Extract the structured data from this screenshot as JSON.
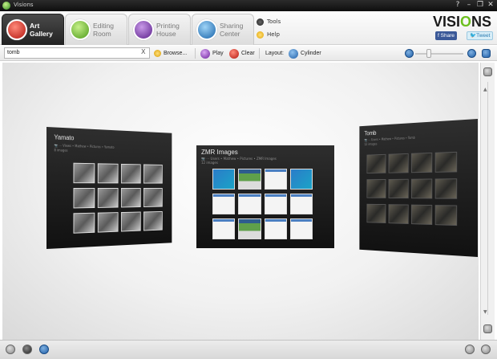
{
  "window": {
    "title": "Visions",
    "min": "?",
    "minimize": "–",
    "restore": "❐",
    "close": "✕"
  },
  "tabs": [
    {
      "line1": "Art",
      "line2": "Gallery",
      "color": "#d8332a",
      "active": true
    },
    {
      "line1": "Editing",
      "line2": "Room",
      "color": "#7dbf2e",
      "active": false
    },
    {
      "line1": "Printing",
      "line2": "House",
      "color": "#7e3fa8",
      "active": false
    },
    {
      "line1": "Sharing",
      "line2": "Center",
      "color": "#2f87c9",
      "active": false
    }
  ],
  "side_links": {
    "tools": "Tools",
    "help": "Help"
  },
  "brand": {
    "pre": "VISI",
    "o": "O",
    "post": "NS",
    "share": "Share",
    "tweet": "Tweet"
  },
  "toolbar": {
    "search_value": "tomb",
    "search_clear": "X",
    "browse": "Browse...",
    "play": "Play",
    "clear": "Clear",
    "layout_label": "Layout:",
    "layout_value": "Cylinder"
  },
  "panels": {
    "left": {
      "title": "Yamato",
      "subtitle": "📷 ⋯ Views • Mathew • Pictures • Yamato",
      "subtitle2": "8 images"
    },
    "center": {
      "title": "ZMR Images",
      "subtitle": "📷 ⋯ Users • Mathew • Pictures • ZMR Images",
      "subtitle2": "12 images"
    },
    "right": {
      "title": "Tomb",
      "subtitle": "📷 ⋯ Users • Mathew • Pictures • Tomb",
      "subtitle2": "12 images"
    }
  },
  "scroll": {
    "up": "▲",
    "down": "▼"
  }
}
